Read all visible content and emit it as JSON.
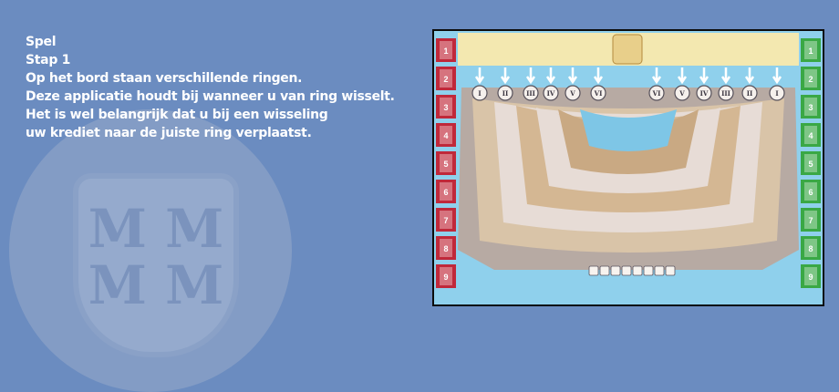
{
  "logo": {
    "letters_top": "M M",
    "letters_bottom": "M M"
  },
  "instructions": {
    "heading": "Spel",
    "step": "Stap 1",
    "lines": [
      "Op het bord staan verschillende ringen.",
      "Deze applicatie houdt bij wanneer u van ring wisselt.",
      "Het is wel belangrijk dat u bij een wisseling",
      "uw krediet naar de juiste ring verplaatst."
    ]
  },
  "board": {
    "ring_labels": [
      "I",
      "II",
      "III",
      "IV",
      "V",
      "VI",
      "VI",
      "V",
      "IV",
      "III",
      "II",
      "I"
    ],
    "left_track": [
      "1",
      "2",
      "3",
      "4",
      "5",
      "6",
      "7",
      "8",
      "9"
    ],
    "right_track": [
      "1",
      "2",
      "3",
      "4",
      "5",
      "6",
      "7",
      "8",
      "9"
    ],
    "colors": {
      "background": "#6b8cc0",
      "water": "#7ec6e6",
      "left_track": "#c0283a",
      "right_track": "#3aa845",
      "top_banner": "#f3e8b0",
      "rings": "#e7dcd6"
    }
  }
}
